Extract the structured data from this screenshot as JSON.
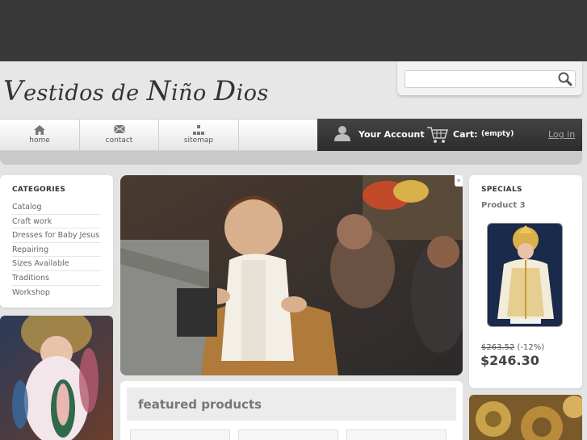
{
  "site": {
    "logo_text": [
      "V",
      "estidos de ",
      "N",
      "iño ",
      "D",
      "ios"
    ]
  },
  "search": {
    "placeholder": "",
    "value": ""
  },
  "nav": {
    "items": [
      {
        "label": "home",
        "icon": "home-icon"
      },
      {
        "label": "contact",
        "icon": "envelope-icon"
      },
      {
        "label": "sitemap",
        "icon": "sitemap-icon"
      }
    ]
  },
  "account": {
    "label": "Your Account",
    "cart_label": "Cart:",
    "cart_value": "(empty)",
    "login_label": "Log in"
  },
  "categories": {
    "title": "CATEGORIES",
    "items": [
      "Catalog",
      "Craft work",
      "Dresses for Baby Jesus",
      "Repairing",
      "Sizes Available",
      "Traditions",
      "Workshop"
    ]
  },
  "hero": {
    "close_glyph": "»"
  },
  "featured": {
    "title": "featured products"
  },
  "specials": {
    "title": "SPECIALS",
    "product_name": "Product 3",
    "old_price": "$263.52",
    "discount": "(-12%)",
    "new_price": "$246.30"
  },
  "colors": {
    "topbar": "#393939",
    "accent_dark": "#2c2c2c",
    "background": "#e3e3e3"
  }
}
